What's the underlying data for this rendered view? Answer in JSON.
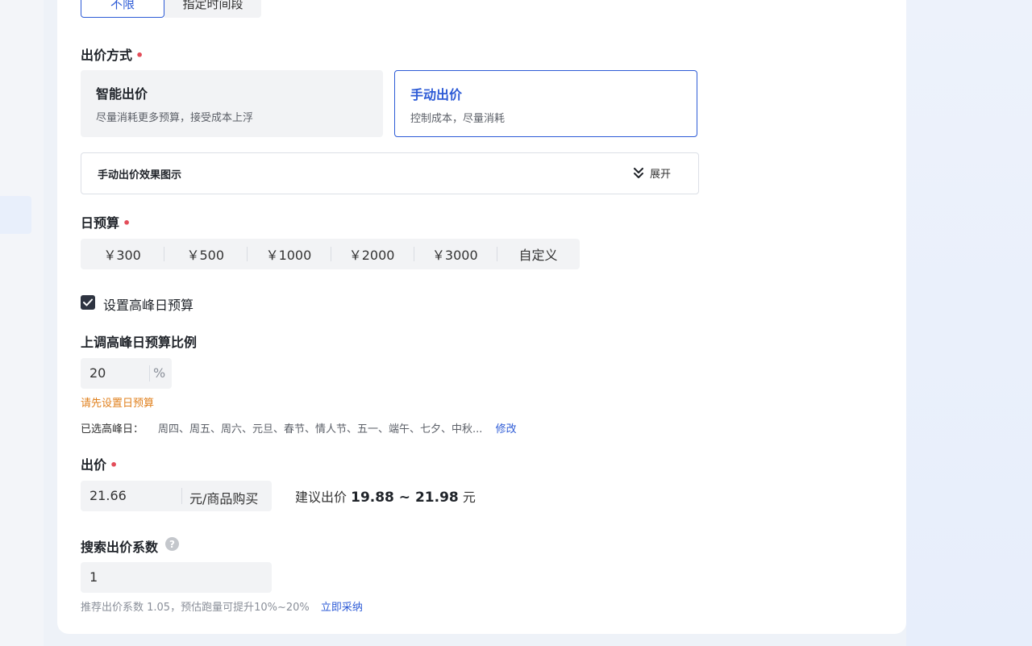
{
  "time_range": {
    "options": [
      "不限",
      "指定时间段"
    ],
    "selected": "不限"
  },
  "bid_method": {
    "label": "出价方式",
    "required_mark": "•",
    "options": [
      {
        "title": "智能出价",
        "desc": "尽量消耗更多预算，接受成本上浮"
      },
      {
        "title": "手动出价",
        "desc": "控制成本，尽量消耗"
      }
    ],
    "selected": "手动出价"
  },
  "effect_panel": {
    "title": "手动出价效果图示",
    "expand_label": "展开"
  },
  "daily_budget": {
    "label": "日预算",
    "required_mark": "•",
    "options": [
      "￥300",
      "￥500",
      "￥1000",
      "￥2000",
      "￥3000",
      "自定义"
    ]
  },
  "peak_budget": {
    "checkbox_label": "设置高峰日预算",
    "checked": true,
    "ratio_label": "上调高峰日预算比例",
    "ratio_value": "20",
    "ratio_unit": "%",
    "warning": "请先设置日预算",
    "selected_label": "已选高峰日：",
    "selected_days": "周四、周五、周六、元旦、春节、情人节、五一、端午、七夕、中秋...",
    "edit_label": "修改"
  },
  "bid": {
    "label": "出价",
    "required_mark": "•",
    "value": "21.66",
    "unit": "元/商品购买",
    "suggest_prefix": "建议出价",
    "suggest_range": "19.88 ~ 21.98",
    "suggest_unit": "元"
  },
  "search_coef": {
    "label": "搜索出价系数",
    "help_glyph": "?",
    "value": "1",
    "tip": "推荐出价系数 1.05，预估跑量可提升10%~20%",
    "adopt_label": "立即采纳"
  },
  "colors": {
    "accent": "#2d5bd6",
    "required": "#e34d59",
    "warning": "#e0801d"
  }
}
